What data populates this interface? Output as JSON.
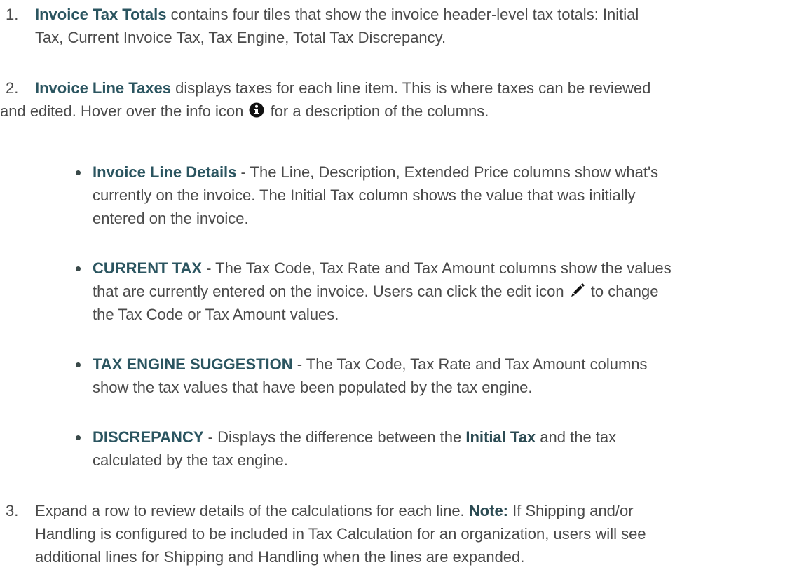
{
  "items": [
    {
      "num": "1.",
      "term": "Invoice Tax Totals",
      "line1_rest": " contains four tiles that show the invoice header-level tax totals: Initial",
      "line2": "Tax, Current Invoice Tax, Tax Engine, Total Tax Discrepancy."
    },
    {
      "num": "2.",
      "term": "Invoice Line Taxes",
      "line1_rest": " displays taxes for each line item. This is where taxes can be reviewed",
      "line2_a": "and edited. Hover over the info icon ",
      "line2_b": " for a description of the columns.",
      "info_icon": "info-icon"
    },
    {
      "num": "3.",
      "line1_a": "Expand a row to review details of the calculations for each line. ",
      "note_label": "Note:",
      "line1_b": " If Shipping and/or",
      "line2": "Handling is configured to be included in Tax Calculation for an organization, users will see",
      "line3": "additional lines for Shipping and Handling when the lines are expanded."
    }
  ],
  "bullets": [
    {
      "term": "Invoice Line Details",
      "line1_rest": " - The Line, Description, Extended Price columns show what's",
      "line2": "currently on the invoice. The Initial Tax column shows the value that was initially",
      "line3": "entered on the invoice."
    },
    {
      "term": "CURRENT TAX",
      "line1_rest": " - The Tax Code, Tax Rate and Tax Amount columns show the values",
      "line2_a": "that are currently entered on the invoice. Users can click the edit icon ",
      "line2_b": " to change",
      "line3": "the Tax Code or Tax Amount values.",
      "edit_icon": "pencil-icon"
    },
    {
      "term": "TAX ENGINE SUGGESTION",
      "line1_rest": " - The Tax Code, Tax Rate and Tax Amount columns",
      "line2": "show the tax values that have been populated by the tax engine."
    },
    {
      "term": "DISCREPANCY",
      "line1_a": " - Displays the difference between the ",
      "bold_term": "Initial Tax",
      "line1_b": " and the tax",
      "line2": "calculated by the tax engine."
    }
  ],
  "colors": {
    "text": "#4a4a4a",
    "term": "#2b5560"
  }
}
